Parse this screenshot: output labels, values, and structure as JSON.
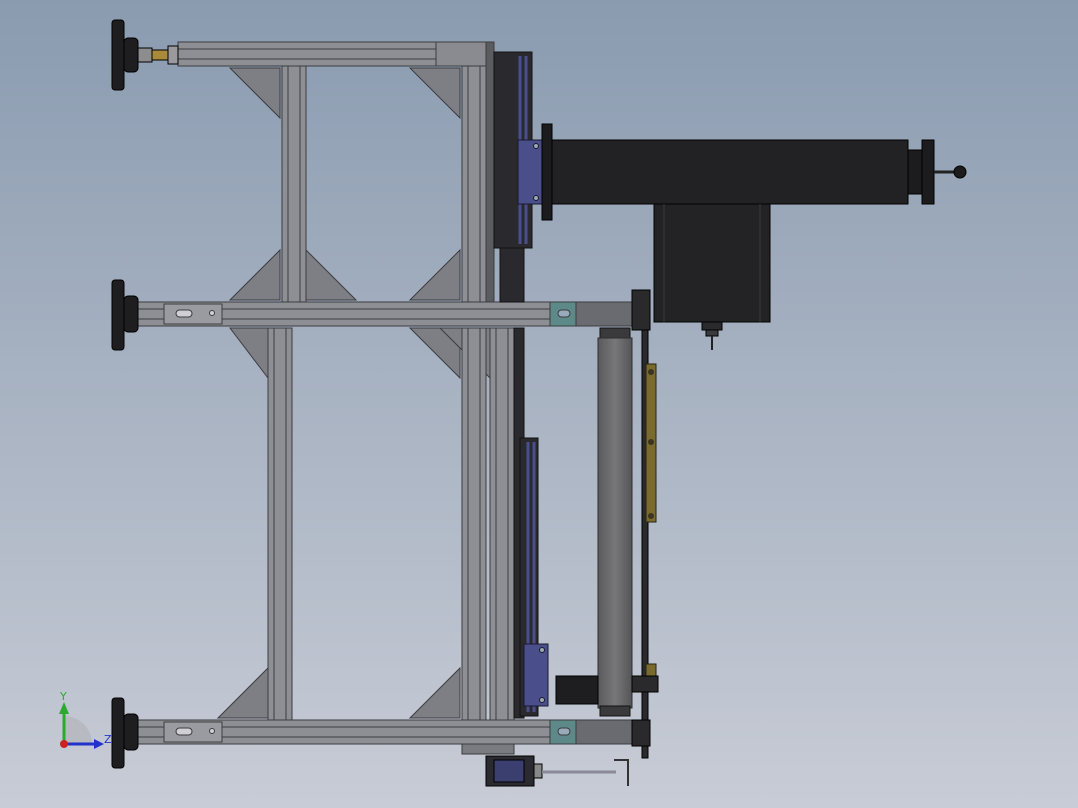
{
  "app": {
    "view": "Front",
    "background": {
      "top": "#8a9bb0",
      "bottom": "#c8ccd6"
    }
  },
  "model": {
    "frame_color": "#8e8f95",
    "frame_edge": "#3c3c40",
    "gusset_color": "#7e7f84",
    "dark_part": "#222224",
    "bearing_blue": "#4a4f8c",
    "roller_gray": "#6b6b6d",
    "brass_color": "#7a6a2e"
  },
  "triad": {
    "y_label": "Y",
    "z_label": "Z",
    "y_color": "#2ea82e",
    "z_color": "#2233cc",
    "origin_color": "#cc2222"
  }
}
